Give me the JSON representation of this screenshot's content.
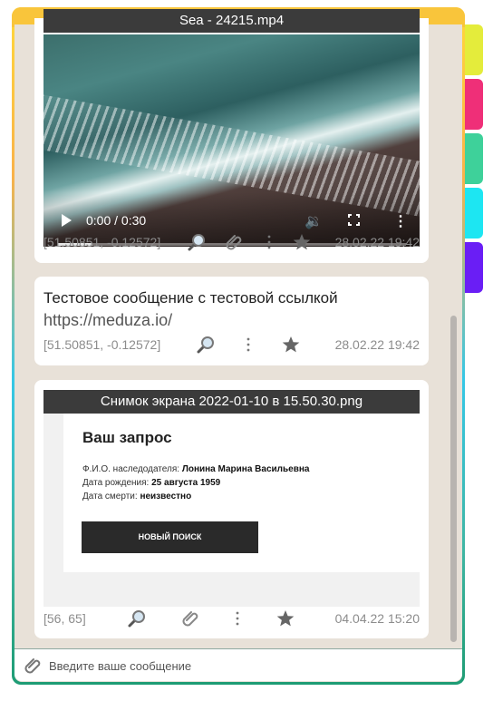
{
  "messages": [
    {
      "type": "video",
      "title": "Sea - 24215.mp4",
      "player": {
        "time": "0:00 / 0:30",
        "progress_fraction": 0.1
      },
      "coords": "[51.50851, -0.12572]",
      "date": "28.02.22 19:42"
    },
    {
      "type": "text",
      "text": "Тестовое сообщение с тестовой ссылкой",
      "link": "https://meduza.io/",
      "coords": "[51.50851, -0.12572]",
      "date": "28.02.22 19:42"
    },
    {
      "type": "image",
      "title": "Снимок экрана 2022-01-10 в 15.50.30.png",
      "screenshot": {
        "heading": "Ваш запрос",
        "line1_label": "Ф.И.О. наследодателя: ",
        "line1_value": "Лонина Марина Васильевна",
        "line2_label": "Дата рождения: ",
        "line2_value": "25 августа 1959",
        "line3_label": "Дата смерти: ",
        "line3_value": "неизвестно",
        "button": "НОВЫЙ ПОИСК"
      },
      "coords": "[56, 65]",
      "date": "04.04.22 15:20"
    }
  ],
  "composer": {
    "placeholder": "Введите ваше сообщение"
  },
  "colors": {
    "tabs": [
      "#e4ec3b",
      "#ef2f78",
      "#3ed19a",
      "#1de6f2",
      "#6a1ef5"
    ],
    "frame_top": "#f9c53b",
    "background": "#e8e1d8"
  },
  "icons": [
    "search-icon",
    "paperclip-icon",
    "more-vertical-icon",
    "star-icon"
  ]
}
